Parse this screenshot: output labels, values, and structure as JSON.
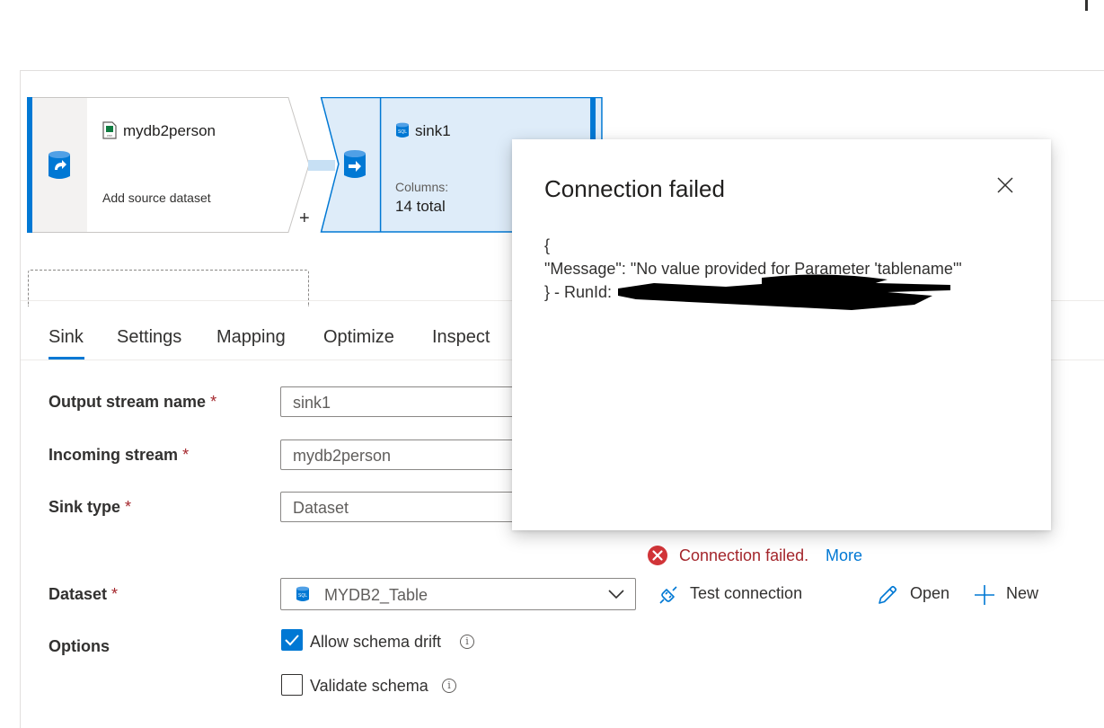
{
  "flow": {
    "source_node": {
      "title": "mydb2person",
      "subtitle": "Add source dataset",
      "icon": "csv-file-icon"
    },
    "sink_node": {
      "title": "sink1",
      "columns_label": "Columns:",
      "columns_value": "14 total",
      "icon": "sql-database-icon"
    },
    "add_symbol": "+"
  },
  "tabs": [
    {
      "label": "Sink",
      "active": true
    },
    {
      "label": "Settings",
      "active": false
    },
    {
      "label": "Mapping",
      "active": false
    },
    {
      "label": "Optimize",
      "active": false
    },
    {
      "label": "Inspect",
      "active": false
    }
  ],
  "form": {
    "output_stream": {
      "label": "Output stream name",
      "required": "*",
      "value": "sink1"
    },
    "incoming_stream": {
      "label": "Incoming stream",
      "required": "*",
      "value": "mydb2person"
    },
    "sink_type": {
      "label": "Sink type",
      "required": "*",
      "value": "Dataset"
    },
    "connection_error": {
      "text": "Connection failed.",
      "more": "More"
    },
    "dataset": {
      "label": "Dataset",
      "required": "*",
      "value": "MYDB2_Table"
    },
    "test_connection_label": "Test connection",
    "open_label": "Open",
    "new_label": "New",
    "options": {
      "label": "Options",
      "allow_schema_drift": {
        "label": "Allow schema drift",
        "checked": true
      },
      "validate_schema": {
        "label": "Validate schema",
        "checked": false
      }
    }
  },
  "modal": {
    "title": "Connection failed",
    "line1": "{",
    "line2": "\"Message\": \"No value provided for Parameter 'tablename'\"",
    "line3": "} - RunId:"
  },
  "colors": {
    "accent": "#0078d4",
    "error": "#a4262c",
    "sink_fill": "#deecf9"
  }
}
